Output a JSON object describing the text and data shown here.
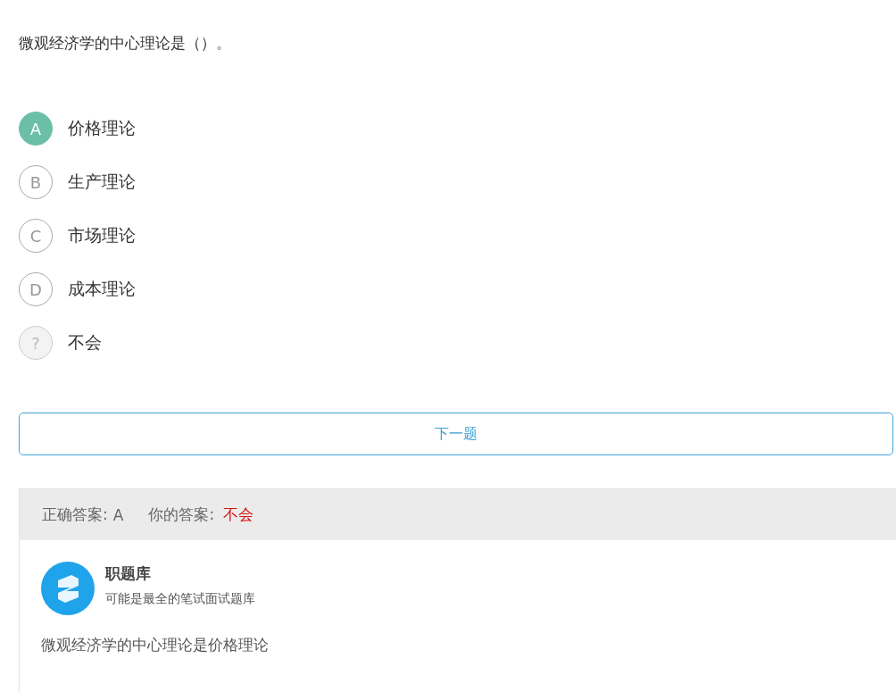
{
  "question": "微观经济学的中心理论是（）。",
  "options": [
    {
      "kind": "letter",
      "marker": "A",
      "label": "价格理论",
      "selected": true
    },
    {
      "kind": "letter",
      "marker": "B",
      "label": "生产理论",
      "selected": false
    },
    {
      "kind": "letter",
      "marker": "C",
      "label": "市场理论",
      "selected": false
    },
    {
      "kind": "letter",
      "marker": "D",
      "label": "成本理论",
      "selected": false
    },
    {
      "kind": "unknown",
      "marker": "?",
      "label": "不会",
      "selected": false
    }
  ],
  "next_button": "下一题",
  "answer": {
    "correct_label": "正确答案:",
    "correct_value": "A",
    "yours_label": "你的答案:",
    "yours_value": "不会"
  },
  "source": {
    "name": "职题库",
    "tagline": "可能是最全的笔试面试题库"
  },
  "explanation": "微观经济学的中心理论是价格理论"
}
